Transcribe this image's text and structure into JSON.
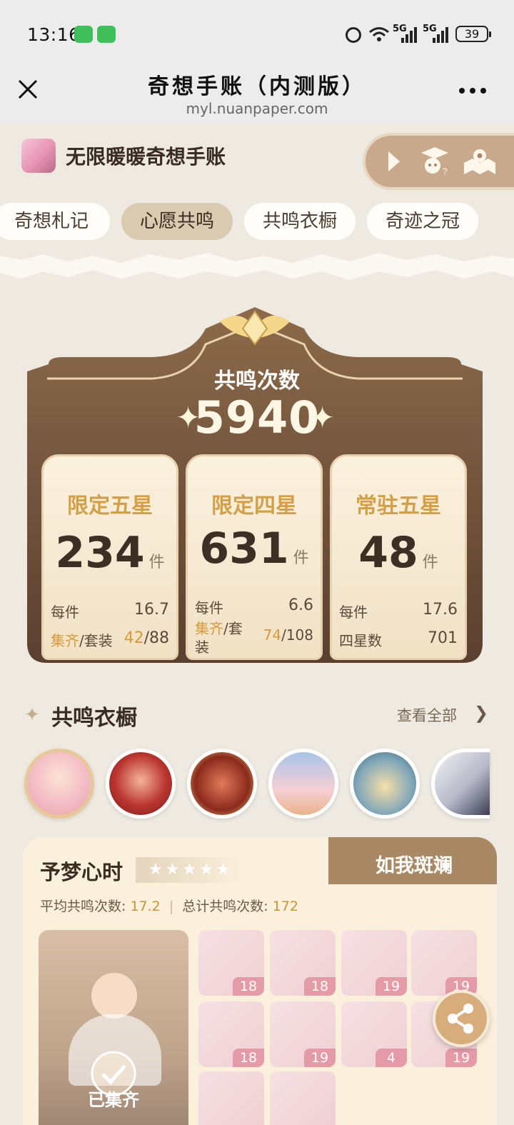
{
  "status_bar": {
    "time": "13:16",
    "network_1": "5G",
    "network_2": "5G",
    "battery": "39"
  },
  "nav": {
    "title": "奇想手账（内测版）",
    "url": "myl.nuanpaper.com"
  },
  "header": {
    "app_name": "无限暖暖奇想手账"
  },
  "tabs": [
    {
      "label": "奇想札记",
      "active": false
    },
    {
      "label": "心愿共鸣",
      "active": true
    },
    {
      "label": "共鸣衣橱",
      "active": false
    },
    {
      "label": "奇迹之冠",
      "active": false
    }
  ],
  "stats": {
    "total_label": "共鸣次数",
    "total_value": "5940",
    "cards": [
      {
        "title": "限定五星",
        "count": "234",
        "unit": "件",
        "row1_label": "每件",
        "row1_value": "16.7",
        "row2_label_a": "集齐",
        "row2_label_b": "/套装",
        "row2_value_a": "42",
        "row2_value_b": "/88"
      },
      {
        "title": "限定四星",
        "count": "631",
        "unit": "件",
        "row1_label": "每件",
        "row1_value": "6.6",
        "row2_label_a": "集齐",
        "row2_label_b": "/套装",
        "row2_value_a": "74",
        "row2_value_b": "/108"
      },
      {
        "title": "常驻五星",
        "count": "48",
        "unit": "件",
        "row1_label": "每件",
        "row1_value": "17.6",
        "row2_label": "四星数",
        "row2_value": "701"
      }
    ]
  },
  "wardrobe": {
    "title": "共鸣衣橱",
    "view_all": "查看全部"
  },
  "collection": {
    "name": "予梦心时",
    "tag": "如我斑斓",
    "stars": "★★★★★",
    "avg_label": "平均共鸣次数:",
    "avg_value": "17.2",
    "total_label": "总计共鸣次数:",
    "total_value": "172",
    "collected_label": "已集齐",
    "items": [
      "18",
      "18",
      "19",
      "19",
      "18",
      "19",
      "4",
      "19",
      "",
      ""
    ]
  },
  "colors": {
    "accent_gold": "#d3a048",
    "card_brown": "#7a5a3c",
    "badge_pink": "#e59aa7",
    "background": "#efeae1"
  }
}
